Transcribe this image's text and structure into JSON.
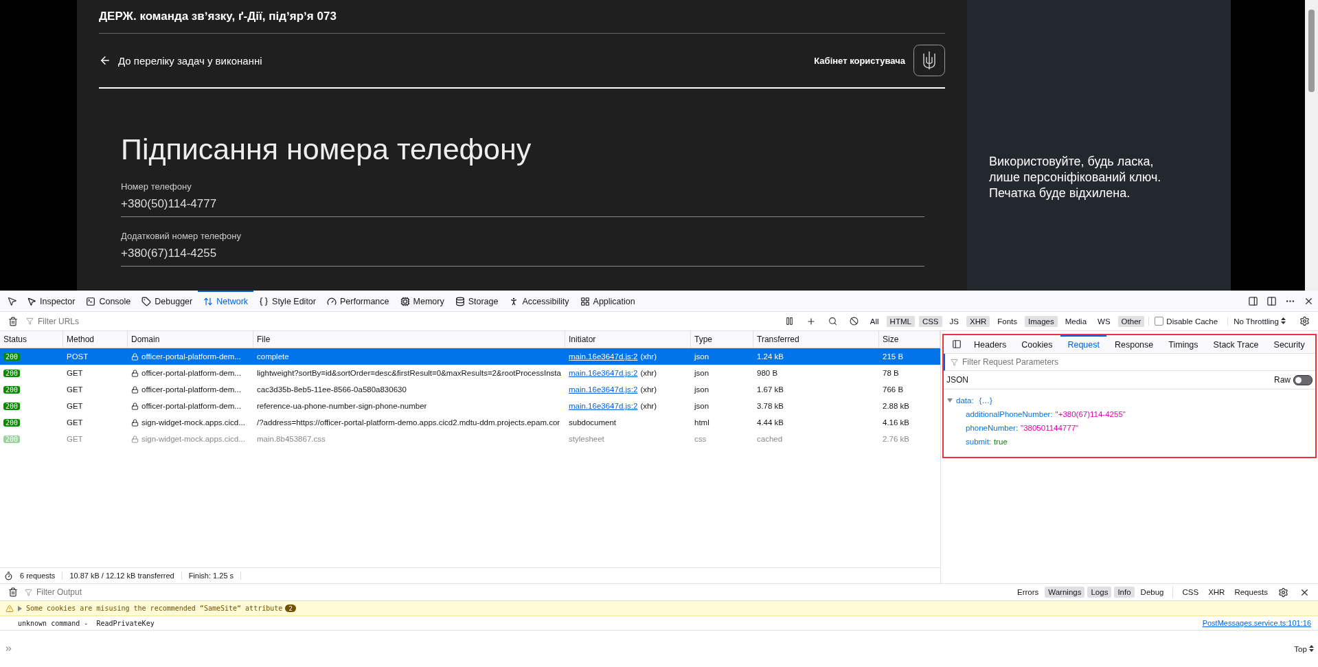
{
  "page": {
    "org_title": "ДЕРЖ. команда звʼязку, ґ-Дії, підʼярʼя 073",
    "back_link": "До переліку задач у виконанні",
    "cabinet_link": "Кабінет користувача",
    "heading": "Підписання номера телефону",
    "fields": [
      {
        "label": "Номер телефону",
        "value": "+380(50)114-4777"
      },
      {
        "label": "Додатковий номер телефону",
        "value": "+380(67)114-4255"
      }
    ],
    "side_note": "Використовуйте, будь ласка, лише персоніфікований ключ. Печатка буде відхилена."
  },
  "devtools": {
    "tabs": [
      {
        "label": "Inspector",
        "selected": false
      },
      {
        "label": "Console",
        "selected": false
      },
      {
        "label": "Debugger",
        "selected": false
      },
      {
        "label": "Network",
        "selected": true
      },
      {
        "label": "Style Editor",
        "selected": false
      },
      {
        "label": "Performance",
        "selected": false
      },
      {
        "label": "Memory",
        "selected": false
      },
      {
        "label": "Storage",
        "selected": false
      },
      {
        "label": "Accessibility",
        "selected": false
      },
      {
        "label": "Application",
        "selected": false
      }
    ],
    "filter_placeholder": "Filter URLs",
    "type_filters": [
      {
        "label": "All",
        "selected": false
      },
      {
        "label": "HTML",
        "selected": true
      },
      {
        "label": "CSS",
        "selected": true
      },
      {
        "label": "JS",
        "selected": false
      },
      {
        "label": "XHR",
        "selected": true
      },
      {
        "label": "Fonts",
        "selected": false
      },
      {
        "label": "Images",
        "selected": true
      },
      {
        "label": "Media",
        "selected": false
      },
      {
        "label": "WS",
        "selected": false
      },
      {
        "label": "Other",
        "selected": true
      }
    ],
    "disable_cache": {
      "label": "Disable Cache",
      "checked": false
    },
    "throttling": "No Throttling",
    "table": {
      "columns": [
        "Status",
        "Method",
        "Domain",
        "File",
        "Initiator",
        "Type",
        "Transferred",
        "Size"
      ],
      "rows": [
        {
          "status": "200",
          "method": "POST",
          "domain": "officer-portal-platform-dem...",
          "file": "complete",
          "initiator": "main.16e3647d.js:2",
          "initiator_note": "(xhr)",
          "type": "json",
          "transferred": "1.24 kB",
          "size": "215 B",
          "selected": true,
          "faded": false
        },
        {
          "status": "200",
          "method": "GET",
          "domain": "officer-portal-platform-dem...",
          "file": "lightweight?sortBy=id&sortOrder=desc&firstResult=0&maxResults=2&rootProcessInsta",
          "initiator": "main.16e3647d.js:2",
          "initiator_note": "(xhr)",
          "type": "json",
          "transferred": "980 B",
          "size": "78 B",
          "selected": false,
          "faded": false
        },
        {
          "status": "200",
          "method": "GET",
          "domain": "officer-portal-platform-dem...",
          "file": "cac3d35b-8eb5-11ee-8566-0a580a830630",
          "initiator": "main.16e3647d.js:2",
          "initiator_note": "(xhr)",
          "type": "json",
          "transferred": "1.67 kB",
          "size": "766 B",
          "selected": false,
          "faded": false
        },
        {
          "status": "200",
          "method": "GET",
          "domain": "officer-portal-platform-dem...",
          "file": "reference-ua-phone-number-sign-phone-number",
          "initiator": "main.16e3647d.js:2",
          "initiator_note": "(xhr)",
          "type": "json",
          "transferred": "3.78 kB",
          "size": "2.88 kB",
          "selected": false,
          "faded": false
        },
        {
          "status": "200",
          "method": "GET",
          "domain": "sign-widget-mock.apps.cicd...",
          "file": "/?address=https://officer-portal-platform-demo.apps.cicd2.mdtu-ddm.projects.epam.cor",
          "initiator": "subdocument",
          "type": "html",
          "transferred": "4.44 kB",
          "size": "4.16 kB",
          "selected": false,
          "faded": false
        },
        {
          "status": "200",
          "method": "GET",
          "domain": "sign-widget-mock.apps.cicd...",
          "file": "main.8b453867.css",
          "initiator": "stylesheet",
          "type": "css",
          "transferred": "cached",
          "size": "2.76 kB",
          "selected": false,
          "faded": true
        }
      ]
    },
    "summary": [
      "6 requests",
      "10.87 kB / 12.12 kB transferred",
      "Finish: 1.25 s"
    ],
    "details": {
      "tabs": [
        {
          "label": "Headers",
          "selected": false
        },
        {
          "label": "Cookies",
          "selected": false
        },
        {
          "label": "Request",
          "selected": true
        },
        {
          "label": "Response",
          "selected": false
        },
        {
          "label": "Timings",
          "selected": false
        },
        {
          "label": "Stack Trace",
          "selected": false
        },
        {
          "label": "Security",
          "selected": false
        }
      ],
      "filter_placeholder": "Filter Request Parameters",
      "section": "JSON",
      "raw": {
        "label": "Raw",
        "on": false
      },
      "root": {
        "key": "data:",
        "preview": "{…}",
        "expanded": true
      },
      "entries": [
        {
          "key": "additionalPhoneNumber:",
          "value": "\"+380(67)114-4255\"",
          "kind": "string"
        },
        {
          "key": "phoneNumber:",
          "value": "\"380501144777\"",
          "kind": "string"
        },
        {
          "key": "submit:",
          "value": "true",
          "kind": "boolean"
        }
      ]
    },
    "console": {
      "filter_placeholder": "Filter Output",
      "levels": [
        {
          "label": "Errors",
          "selected": false
        },
        {
          "label": "Warnings",
          "selected": true
        },
        {
          "label": "Logs",
          "selected": true
        },
        {
          "label": "Info",
          "selected": true
        },
        {
          "label": "Debug",
          "selected": false
        }
      ],
      "types": [
        {
          "label": "CSS",
          "selected": false
        },
        {
          "label": "XHR",
          "selected": false
        },
        {
          "label": "Requests",
          "selected": false
        }
      ],
      "warning": {
        "text": "Some cookies are misusing the recommended “SameSite“ attribute",
        "count": "2"
      },
      "message": {
        "text": "unknown command -  ReadPrivateKey",
        "source": "PostMessages.service.ts:101:16"
      },
      "context": "Top"
    }
  }
}
